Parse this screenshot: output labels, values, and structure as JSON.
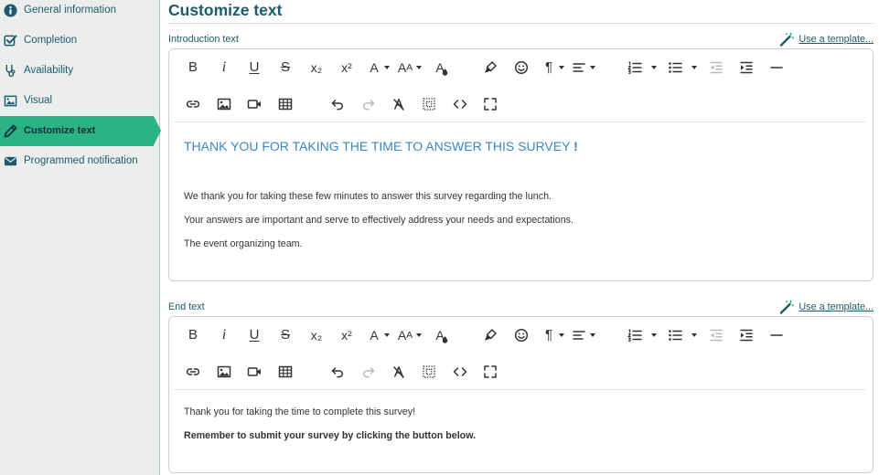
{
  "sidebar": {
    "items": [
      {
        "label": "General information",
        "icon": "info-icon"
      },
      {
        "label": "Completion",
        "icon": "checkbox-icon"
      },
      {
        "label": "Availability",
        "icon": "availability-icon"
      },
      {
        "label": "Visual",
        "icon": "image-icon"
      },
      {
        "label": "Customize text",
        "icon": "pencil-icon",
        "active": true
      },
      {
        "label": "Programmed notification",
        "icon": "envelope-icon"
      }
    ]
  },
  "page": {
    "title": "Customize text"
  },
  "editors": [
    {
      "label": "Introduction text",
      "template_link": {
        "label": "Use a template...",
        "icon": "magic-wand-icon"
      },
      "content": {
        "heading": [
          {
            "text": "THANK YOU FOR TAKING THE TIME TO ANSWER THIS SURVEY "
          },
          {
            "text": "!",
            "bold": true
          }
        ],
        "paragraphs": [
          {
            "text": "We thank you for taking these few minutes to answer this survey regarding the lunch."
          },
          {
            "text": "Your answers are important and serve to effectively address your needs and expectations."
          },
          {
            "text": "The event organizing team."
          }
        ]
      }
    },
    {
      "label": "End text",
      "template_link": {
        "label": "Use a template...",
        "icon": "magic-wand-icon"
      },
      "content": {
        "paragraphs": [
          {
            "text": "Thank you for taking the time to complete this survey!"
          },
          {
            "text": "Remember to submit your survey by clicking the button below.",
            "bold": true
          }
        ]
      }
    }
  ],
  "toolbar": {
    "rows": [
      [
        {
          "icon": "bold-icon",
          "glyph": "B"
        },
        {
          "icon": "italic-icon",
          "glyph": "i"
        },
        {
          "icon": "underline-icon",
          "glyph": "U"
        },
        {
          "icon": "strikethrough-icon",
          "glyph": "S"
        },
        {
          "icon": "subscript-icon",
          "glyph": "x₂"
        },
        {
          "icon": "superscript-icon",
          "glyph": "x²"
        },
        {
          "icon": "font-size-icon",
          "glyph": "A",
          "dropdown": true
        },
        {
          "icon": "font-family-icon",
          "glyph": "A",
          "glyph2": "A",
          "dropdown": true
        },
        {
          "icon": "text-color-icon",
          "glyph": "A"
        },
        {
          "icon": "highlighter-icon"
        },
        {
          "icon": "emoticon-icon"
        },
        {
          "icon": "paragraph-format-icon",
          "glyph": "¶",
          "dropdown": true
        },
        {
          "icon": "align-icon",
          "dropdown": true
        },
        {
          "icon": "ordered-list-icon",
          "dropdown": true
        },
        {
          "icon": "unordered-list-icon",
          "dropdown": true
        },
        {
          "icon": "outdent-icon",
          "disabled": true
        },
        {
          "icon": "indent-icon"
        },
        {
          "icon": "horizontal-line-icon"
        }
      ],
      [
        {
          "icon": "link-icon"
        },
        {
          "icon": "image-icon"
        },
        {
          "icon": "video-icon"
        },
        {
          "icon": "table-icon"
        },
        {
          "icon": "undo-icon"
        },
        {
          "icon": "redo-icon",
          "disabled": true
        },
        {
          "icon": "clear-formatting-icon"
        },
        {
          "icon": "select-all-icon"
        },
        {
          "icon": "code-view-icon"
        },
        {
          "icon": "fullscreen-icon"
        }
      ]
    ]
  },
  "colors": {
    "accent": "#2bb383",
    "primary": "#1d5a6a",
    "heading": "#3a86c5",
    "text": "#333333",
    "disabled": "#b9b9b9"
  }
}
